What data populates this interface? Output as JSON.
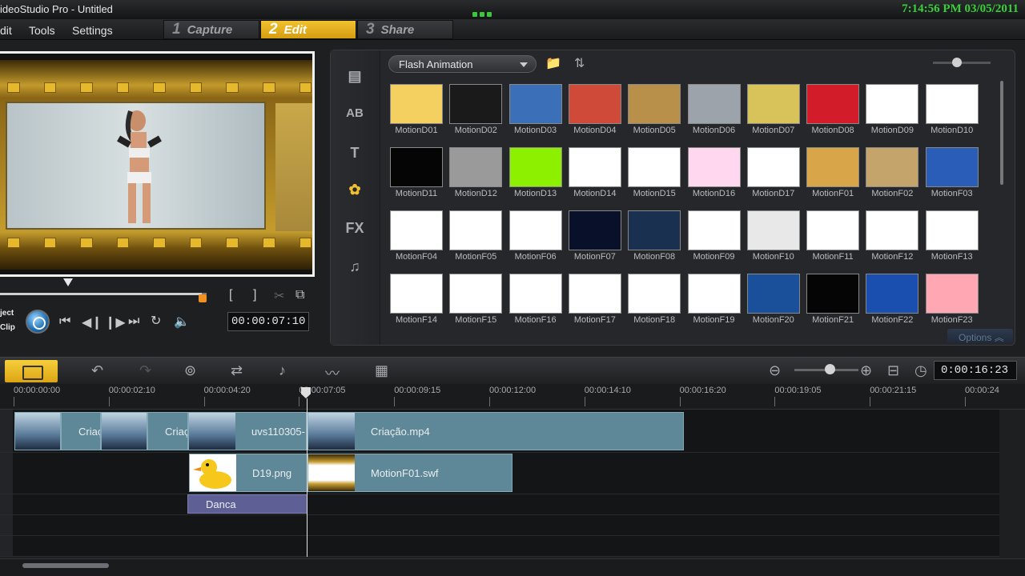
{
  "window": {
    "title": "ideoStudio Pro - Untitled",
    "clock": "7:14:56 PM 03/05/2011"
  },
  "menu": {
    "items": [
      "dit",
      "Tools",
      "Settings"
    ]
  },
  "steps": [
    {
      "num": "1",
      "label": "Capture",
      "active": false
    },
    {
      "num": "2",
      "label": "Edit",
      "active": true
    },
    {
      "num": "3",
      "label": "Share",
      "active": false
    }
  ],
  "player": {
    "mode_project": "ject",
    "mode_clip": "Clip",
    "timecode": "00:00:07:10",
    "scrub_position_fraction": 0.33
  },
  "library": {
    "category": "Flash Animation",
    "options_label": "Options",
    "tabs": [
      "media-icon",
      "transition-icon",
      "title-icon",
      "graphic-icon",
      "filter-icon",
      "audio-icon"
    ],
    "tab_glyphs": [
      "▤",
      "AB",
      "T",
      "✿",
      "FX",
      "♫"
    ],
    "thumbnails": [
      "MotionD01",
      "MotionD02",
      "MotionD03",
      "MotionD04",
      "MotionD05",
      "MotionD06",
      "MotionD07",
      "MotionD08",
      "MotionD09",
      "MotionD10",
      "MotionD11",
      "MotionD12",
      "MotionD13",
      "MotionD14",
      "MotionD15",
      "MotionD16",
      "MotionD17",
      "MotionF01",
      "MotionF02",
      "MotionF03",
      "MotionF04",
      "MotionF05",
      "MotionF06",
      "MotionF07",
      "MotionF08",
      "MotionF09",
      "MotionF10",
      "MotionF11",
      "MotionF12",
      "MotionF13",
      "MotionF14",
      "MotionF15",
      "MotionF16",
      "MotionF17",
      "MotionF18",
      "MotionF19",
      "MotionF20",
      "MotionF21",
      "MotionF22",
      "MotionF23"
    ],
    "thumb_colors": [
      "#f4d060",
      "#1a1a1a",
      "#3b6fb8",
      "#d04a3a",
      "#b8904a",
      "#9da3aa",
      "#d8c25a",
      "#d21c2a",
      "#ffffff",
      "#ffffff",
      "#050505",
      "#9a9a9a",
      "#8cf000",
      "#ffffff",
      "#ffffff",
      "#ffd8f0",
      "#ffffff",
      "#d8a648",
      "#c4a46a",
      "#2a5db8",
      "#ffffff",
      "#ffffff",
      "#ffffff",
      "#08102a",
      "#1a3050",
      "#ffffff",
      "#e8e8e8",
      "#ffffff",
      "#ffffff",
      "#ffffff",
      "#ffffff",
      "#ffffff",
      "#ffffff",
      "#ffffff",
      "#ffffff",
      "#ffffff",
      "#1a4f9a",
      "#050505",
      "#1a4fb0",
      "#ffa8b4"
    ]
  },
  "timeline": {
    "duration": "0:00:16:23",
    "ruler": [
      "00:00:00:00",
      "00:00:02:10",
      "00:00:04:20",
      "00:00:07:05",
      "00:00:09:15",
      "00:00:12:00",
      "00:00:14:10",
      "00:00:16:20",
      "00:00:19:05",
      "00:00:21:15",
      "00:00:24"
    ],
    "video_clips": [
      {
        "label": "",
        "thumb": true
      },
      {
        "label": "Criaç",
        "thumb": false
      },
      {
        "label": "",
        "thumb": true
      },
      {
        "label": "Criaç",
        "thumb": false
      },
      {
        "label": "uvs110305-",
        "thumb": true
      },
      {
        "label": "Criação.mp4",
        "thumb": true
      }
    ],
    "overlay_clips": [
      {
        "label": "D19.png"
      },
      {
        "label": "MotionF01.swf"
      }
    ],
    "title_clip": "Danca"
  }
}
